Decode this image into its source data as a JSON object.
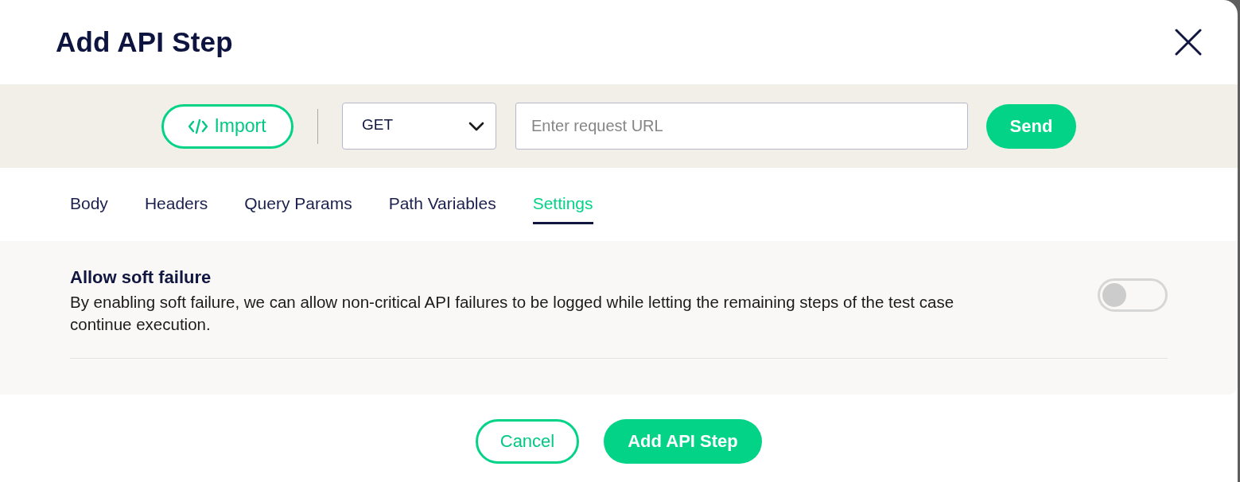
{
  "dialog": {
    "title": "Add API Step"
  },
  "request_bar": {
    "import_button": "Import",
    "method": {
      "value": "GET"
    },
    "url": {
      "placeholder": "Enter request URL"
    },
    "send_button": "Send"
  },
  "tabs": [
    {
      "label": "Body",
      "selected": false
    },
    {
      "label": "Headers",
      "selected": false
    },
    {
      "label": "Query Params",
      "selected": false
    },
    {
      "label": "Path Variables",
      "selected": false
    },
    {
      "label": "Settings",
      "selected": true
    }
  ],
  "settings": [
    {
      "kind": "toggle",
      "title": "Allow soft failure",
      "description": "By enabling soft failure, we can allow non-critical API failures to be logged while letting the remaining steps of the test case continue execution.",
      "on": false
    }
  ],
  "footer": {
    "buttons": [
      {
        "label": "Cancel",
        "kind": "secondary"
      },
      {
        "label": "Add API Step",
        "kind": "primary"
      }
    ]
  }
}
